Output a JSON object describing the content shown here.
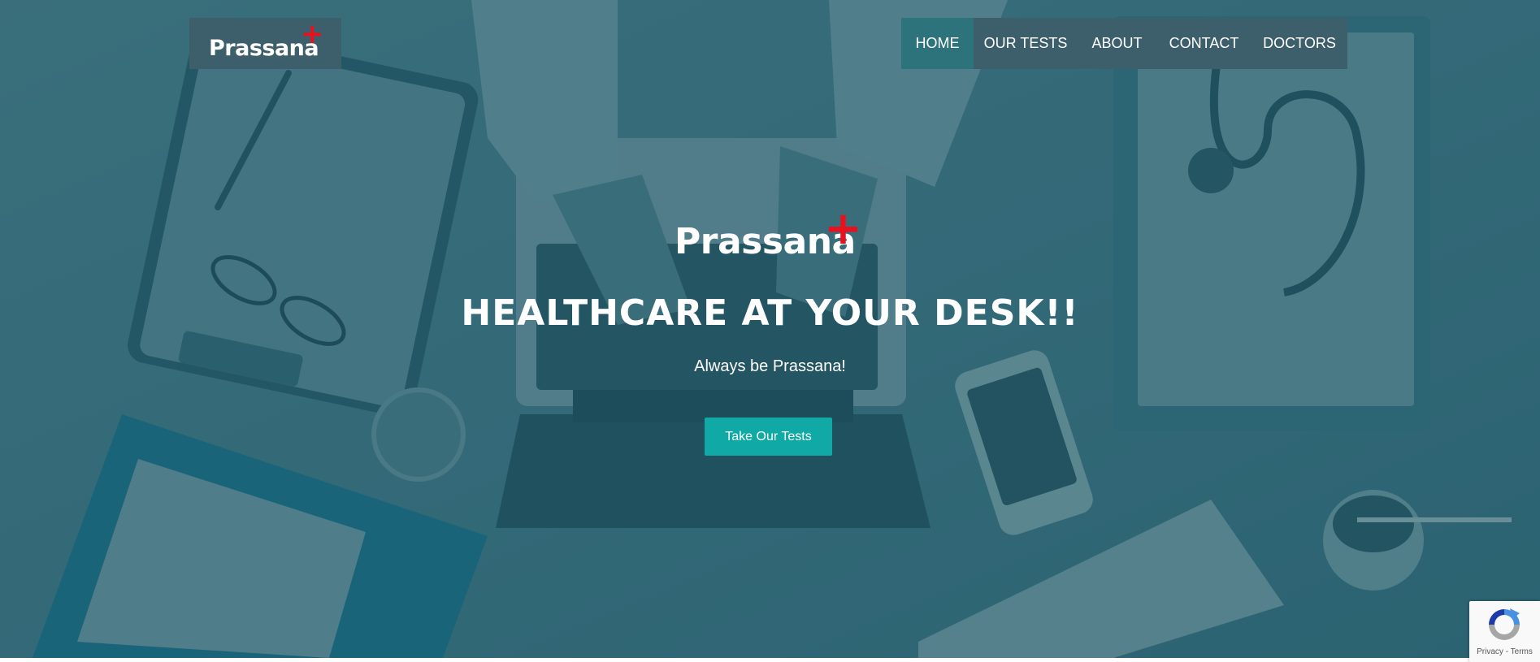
{
  "brand": {
    "name": "Prassana",
    "mark": "+",
    "accent_color": "#e8121f"
  },
  "nav": {
    "items": [
      {
        "label": "HOME",
        "active": true
      },
      {
        "label": "OUR TESTS"
      },
      {
        "label": "ABOUT"
      },
      {
        "label": "CONTACT"
      },
      {
        "label": "DOCTORS"
      }
    ]
  },
  "hero": {
    "headline": "HEALTHCARE AT YOUR DESK!!",
    "tagline": "Always be Prassana!",
    "cta_label": "Take Our Tests",
    "cta_color": "#10a9a5",
    "overlay_color": "#1e5564"
  },
  "recaptcha": {
    "icon": "recaptcha-icon",
    "privacy_label": "Privacy",
    "separator": "-",
    "terms_label": "Terms"
  }
}
